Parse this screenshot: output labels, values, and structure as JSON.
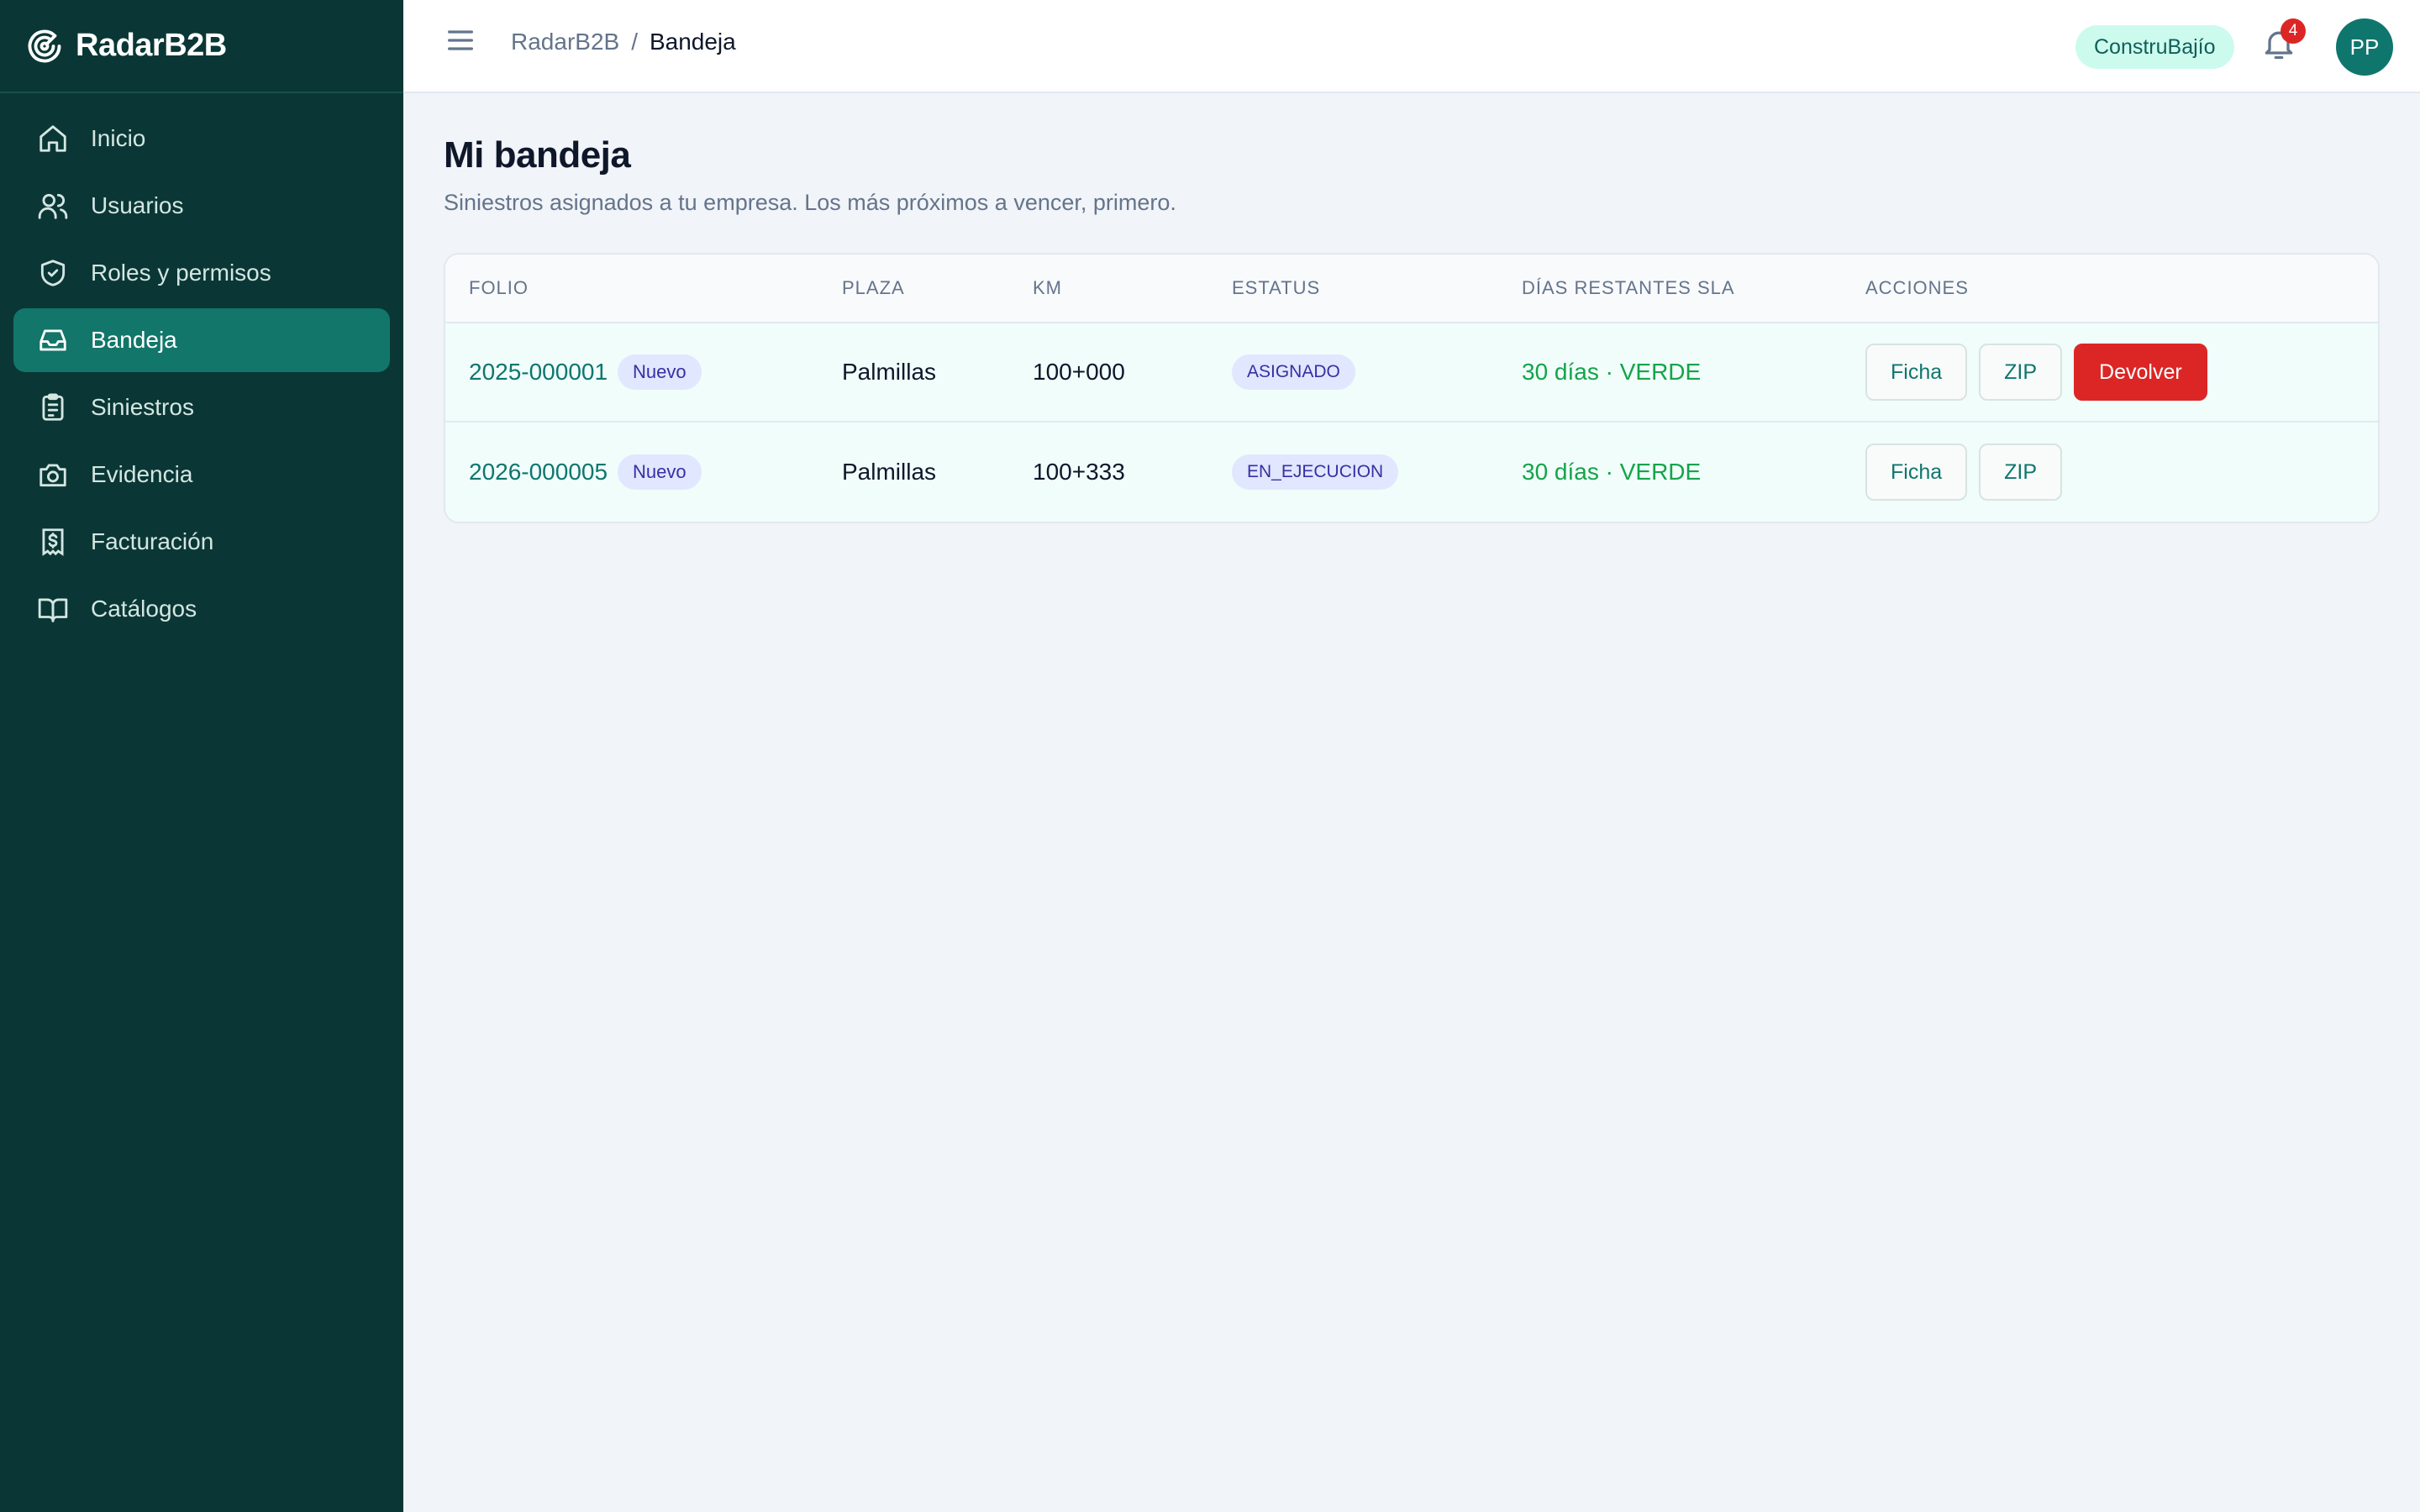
{
  "app": {
    "name": "RadarB2B"
  },
  "sidebar": {
    "items": [
      {
        "label": "Inicio",
        "icon": "home-icon"
      },
      {
        "label": "Usuarios",
        "icon": "users-icon"
      },
      {
        "label": "Roles y permisos",
        "icon": "shield-icon"
      },
      {
        "label": "Bandeja",
        "icon": "inbox-icon",
        "active": true
      },
      {
        "label": "Siniestros",
        "icon": "clipboard-icon"
      },
      {
        "label": "Evidencia",
        "icon": "camera-icon"
      },
      {
        "label": "Facturación",
        "icon": "receipt-icon"
      },
      {
        "label": "Catálogos",
        "icon": "book-icon"
      }
    ]
  },
  "header": {
    "breadcrumb_root": "RadarB2B",
    "breadcrumb_sep": "/",
    "breadcrumb_current": "Bandeja",
    "company": "ConstruBajío",
    "notifications_count": "4",
    "avatar_initials": "PP"
  },
  "main": {
    "title": "Mi bandeja",
    "subtitle": "Siniestros asignados a tu empresa. Los más próximos a vencer, primero.",
    "columns": [
      "FOLIO",
      "PLAZA",
      "KM",
      "ESTATUS",
      "DÍAS RESTANTES SLA",
      "ACCIONES"
    ],
    "rows": [
      {
        "folio": "2025-000001",
        "tag": "Nuevo",
        "plaza": "Palmillas",
        "km": "100+000",
        "status": "ASIGNADO",
        "sla": "30 días · VERDE",
        "btn_ficha": "Ficha",
        "btn_zip": "ZIP",
        "btn_devolver": "Devolver"
      },
      {
        "folio": "2026-000005",
        "tag": "Nuevo",
        "plaza": "Palmillas",
        "km": "100+333",
        "status": "EN_EJECUCION",
        "sla": "30 días · VERDE",
        "btn_ficha": "Ficha",
        "btn_zip": "ZIP"
      }
    ]
  },
  "colors": {
    "sidebar_bg": "#0a3735",
    "active_item": "#12766a",
    "accent": "#0f766e",
    "danger": "#dc2626",
    "sla_green": "#16a34a"
  }
}
